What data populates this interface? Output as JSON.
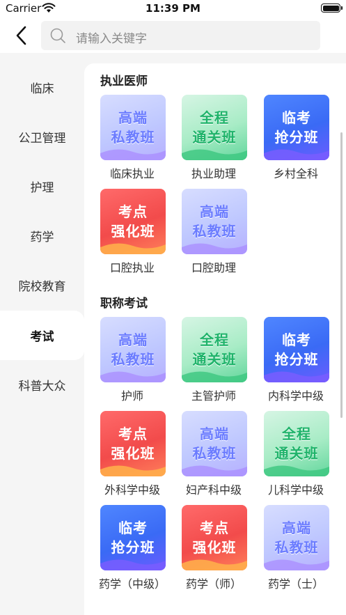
{
  "status_bar": {
    "carrier": "Carrier",
    "time": "11:39 PM"
  },
  "search": {
    "placeholder": "请输入关键字"
  },
  "sidebar": {
    "items": [
      {
        "label": "临床",
        "active": false
      },
      {
        "label": "公卫管理",
        "active": false
      },
      {
        "label": "护理",
        "active": false
      },
      {
        "label": "药学",
        "active": false
      },
      {
        "label": "院校教育",
        "active": false
      },
      {
        "label": "考试",
        "active": true
      },
      {
        "label": "科普大众",
        "active": false
      }
    ]
  },
  "sections": [
    {
      "title": "执业医师",
      "cards": [
        {
          "label": "临床执业",
          "badge": [
            "高端",
            "私教班"
          ],
          "theme": "purple"
        },
        {
          "label": "执业助理",
          "badge": [
            "全程",
            "通关班"
          ],
          "theme": "green"
        },
        {
          "label": "乡村全科",
          "badge": [
            "临考",
            "抢分班"
          ],
          "theme": "blue"
        },
        {
          "label": "口腔执业",
          "badge": [
            "考点",
            "强化班"
          ],
          "theme": "red"
        },
        {
          "label": "口腔助理",
          "badge": [
            "高端",
            "私教班"
          ],
          "theme": "purple"
        }
      ]
    },
    {
      "title": "职称考试",
      "cards": [
        {
          "label": "护师",
          "badge": [
            "高端",
            "私教班"
          ],
          "theme": "purple"
        },
        {
          "label": "主管护师",
          "badge": [
            "全程",
            "通关班"
          ],
          "theme": "green"
        },
        {
          "label": "内科学中级",
          "badge": [
            "临考",
            "抢分班"
          ],
          "theme": "blue"
        },
        {
          "label": "外科学中级",
          "badge": [
            "考点",
            "强化班"
          ],
          "theme": "red"
        },
        {
          "label": "妇产科中级",
          "badge": [
            "高端",
            "私教班"
          ],
          "theme": "purple"
        },
        {
          "label": "儿科学中级",
          "badge": [
            "全程",
            "通关班"
          ],
          "theme": "green"
        },
        {
          "label": "药学（中级）",
          "badge": [
            "临考",
            "抢分班"
          ],
          "theme": "blue"
        },
        {
          "label": "药学（师）",
          "badge": [
            "考点",
            "强化班"
          ],
          "theme": "red"
        },
        {
          "label": "药学（士）",
          "badge": [
            "高端",
            "私教班"
          ],
          "theme": "purple"
        }
      ]
    }
  ]
}
